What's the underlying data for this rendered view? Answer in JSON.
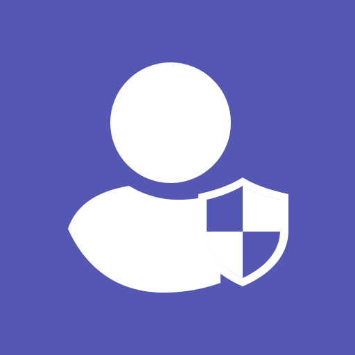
{
  "icon": {
    "name": "user-security-icon",
    "background_color": "#5558B3",
    "foreground_color": "#FFFFFF",
    "shield_fill_color": "#5558B3"
  }
}
